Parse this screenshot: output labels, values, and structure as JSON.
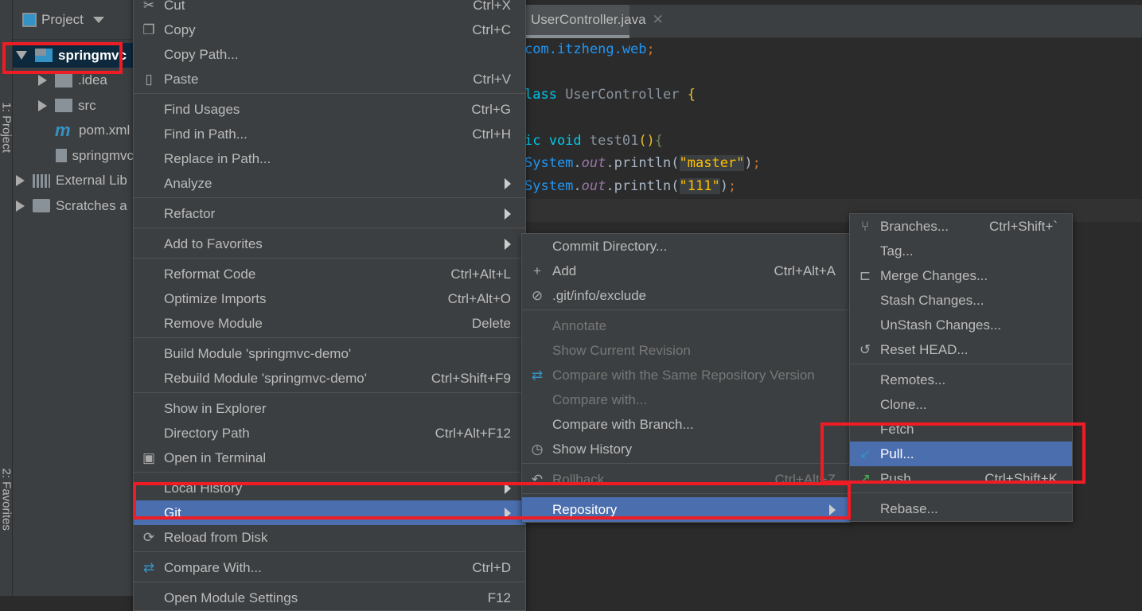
{
  "sidebar_strip": {
    "labels": [
      "1: Project",
      "2: Favorites"
    ]
  },
  "project_panel": {
    "title": "Project",
    "tree": [
      {
        "label": "springmvc",
        "icon": "module-folder-icon",
        "expanded": true,
        "selected": true,
        "depth": 0
      },
      {
        "label": ".idea",
        "icon": "folder-icon",
        "depth": 1
      },
      {
        "label": "src",
        "icon": "folder-icon",
        "depth": 1
      },
      {
        "label": "pom.xml",
        "icon": "maven-icon",
        "depth": 1
      },
      {
        "label": "springmvc",
        "icon": "file-icon",
        "depth": 1
      },
      {
        "label": "External Lib",
        "icon": "library-icon",
        "depth": 0
      },
      {
        "label": "Scratches a",
        "icon": "scratches-icon",
        "depth": 0
      }
    ]
  },
  "editor": {
    "tab": "UserController.java",
    "lines": [
      [
        [
          "pk",
          "com.itzheng.web"
        ],
        [
          "sym",
          ";"
        ]
      ],
      [],
      [
        [
          "kw",
          "lass "
        ],
        [
          "id",
          "UserController "
        ],
        [
          "br",
          "{"
        ]
      ],
      [],
      [
        [
          "kw",
          "ic void "
        ],
        [
          "id",
          "test01"
        ],
        [
          "br",
          "()"
        ],
        [
          "gr",
          "{"
        ]
      ],
      [
        [
          "pk",
          "System"
        ],
        [
          "fn",
          "."
        ],
        [
          "out",
          "out"
        ],
        [
          "fn",
          ".println("
        ],
        [
          "str",
          "\"master\""
        ],
        [
          "fn",
          ")"
        ],
        [
          "sym",
          ";"
        ]
      ],
      [
        [
          "pk",
          "System"
        ],
        [
          "fn",
          "."
        ],
        [
          "out",
          "out"
        ],
        [
          "fn",
          ".println("
        ],
        [
          "str",
          "\"111\""
        ],
        [
          "fn",
          ")"
        ],
        [
          "sym",
          ";"
        ]
      ]
    ]
  },
  "context_menu": {
    "items": [
      {
        "label": "Cut",
        "shortcut": "Ctrl+X",
        "icon": "cut-icon"
      },
      {
        "label": "Copy",
        "shortcut": "Ctrl+C",
        "icon": "copy-icon"
      },
      {
        "label": "Copy Path...",
        "shortcut": ""
      },
      {
        "label": "Paste",
        "shortcut": "Ctrl+V",
        "icon": "paste-icon"
      },
      {
        "sep": true
      },
      {
        "label": "Find Usages",
        "shortcut": "Ctrl+G"
      },
      {
        "label": "Find in Path...",
        "shortcut": "Ctrl+H"
      },
      {
        "label": "Replace in Path...",
        "shortcut": ""
      },
      {
        "label": "Analyze",
        "submenu": true
      },
      {
        "sep": true
      },
      {
        "label": "Refactor",
        "submenu": true
      },
      {
        "sep": true
      },
      {
        "label": "Add to Favorites",
        "submenu": true
      },
      {
        "sep": true
      },
      {
        "label": "Reformat Code",
        "shortcut": "Ctrl+Alt+L"
      },
      {
        "label": "Optimize Imports",
        "shortcut": "Ctrl+Alt+O"
      },
      {
        "label": "Remove Module",
        "shortcut": "Delete"
      },
      {
        "sep": true
      },
      {
        "label": "Build Module 'springmvc-demo'",
        "shortcut": ""
      },
      {
        "label": "Rebuild Module 'springmvc-demo'",
        "shortcut": "Ctrl+Shift+F9"
      },
      {
        "sep": true
      },
      {
        "label": "Show in Explorer",
        "shortcut": ""
      },
      {
        "label": "Directory Path",
        "shortcut": "Ctrl+Alt+F12"
      },
      {
        "label": "Open in Terminal",
        "shortcut": "",
        "icon": "terminal-icon"
      },
      {
        "sep": true
      },
      {
        "label": "Local History",
        "submenu": true
      },
      {
        "label": "Git",
        "submenu": true,
        "highlighted": true
      },
      {
        "label": "Reload from Disk",
        "shortcut": "",
        "icon": "reload-icon"
      },
      {
        "sep": true
      },
      {
        "label": "Compare With...",
        "shortcut": "Ctrl+D",
        "icon": "compare-icon"
      },
      {
        "sep": true
      },
      {
        "label": "Open Module Settings",
        "shortcut": "F12"
      }
    ]
  },
  "git_menu": {
    "items": [
      {
        "label": "Commit Directory...",
        "shortcut": ""
      },
      {
        "label": "Add",
        "shortcut": "Ctrl+Alt+A",
        "icon": "plus-icon"
      },
      {
        "label": ".git/info/exclude",
        "shortcut": "",
        "icon": "ignore-file-icon"
      },
      {
        "sep": true
      },
      {
        "label": "Annotate",
        "disabled": true
      },
      {
        "label": "Show Current Revision",
        "disabled": true
      },
      {
        "label": "Compare with the Same Repository Version",
        "disabled": true,
        "icon": "compare-icon"
      },
      {
        "label": "Compare with...",
        "disabled": true
      },
      {
        "label": "Compare with Branch...",
        "shortcut": ""
      },
      {
        "label": "Show History",
        "shortcut": "",
        "icon": "history-icon"
      },
      {
        "sep": true
      },
      {
        "label": "Rollback",
        "shortcut": "Ctrl+Alt+Z",
        "disabled": true,
        "icon": "rollback-icon"
      },
      {
        "sep": true
      },
      {
        "label": "Repository",
        "submenu": true,
        "highlighted": true
      }
    ]
  },
  "repository_menu": {
    "items": [
      {
        "label": "Branches...",
        "shortcut": "Ctrl+Shift+`",
        "icon": "branch-icon"
      },
      {
        "label": "Tag...",
        "shortcut": ""
      },
      {
        "label": "Merge Changes...",
        "shortcut": "",
        "icon": "merge-icon"
      },
      {
        "label": "Stash Changes...",
        "shortcut": ""
      },
      {
        "label": "UnStash Changes...",
        "shortcut": ""
      },
      {
        "label": "Reset HEAD...",
        "shortcut": "",
        "icon": "reset-icon"
      },
      {
        "sep": true
      },
      {
        "label": "Remotes...",
        "shortcut": ""
      },
      {
        "label": "Clone...",
        "shortcut": ""
      },
      {
        "label": "Fetch",
        "shortcut": ""
      },
      {
        "label": "Pull...",
        "shortcut": "",
        "highlighted": true,
        "icon": "pull-icon"
      },
      {
        "label": "Push",
        "shortcut": "Ctrl+Shift+K",
        "icon": "push-icon"
      },
      {
        "sep": true
      },
      {
        "label": "Rebase...",
        "shortcut": ""
      }
    ]
  },
  "colors": {
    "highlight": "#4b6eaf",
    "annotation_red": "#ee1c24",
    "menu_bg": "#3c3f41",
    "editor_bg": "#2b2b2b"
  }
}
